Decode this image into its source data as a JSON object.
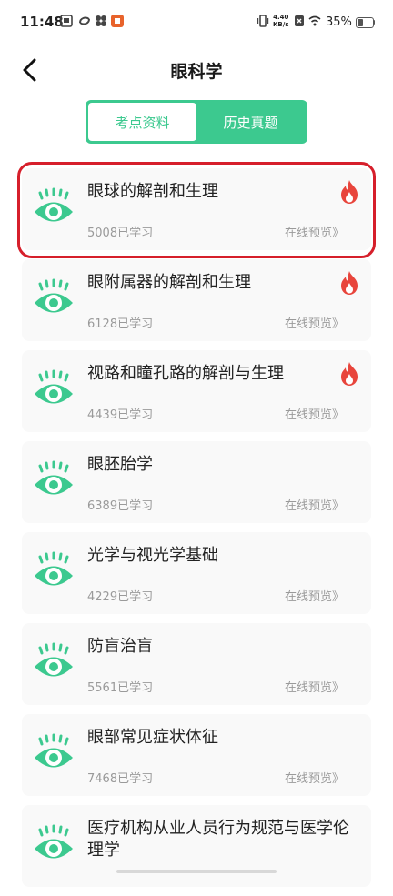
{
  "status_bar": {
    "time": "11:48",
    "net_speed_value": "4.40",
    "net_speed_unit": "KB/s",
    "battery_percent": "35%",
    "battery_level": 0.35
  },
  "header": {
    "title": "眼科学"
  },
  "tabs": [
    {
      "label": "考点资料",
      "active": true
    },
    {
      "label": "历史真题",
      "active": false
    }
  ],
  "accent_color": "#3cc98f",
  "hot_color": "#e8453c",
  "highlight_color": "#d61f2b",
  "courses": [
    {
      "title": "眼球的解剖和生理",
      "learned": "5008已学习",
      "preview": "在线预览》",
      "hot": true,
      "icon": "eye-icon"
    },
    {
      "title": "眼附属器的解剖和生理",
      "learned": "6128已学习",
      "preview": "在线预览》",
      "hot": true,
      "icon": "eye-icon"
    },
    {
      "title": "视路和瞳孔路的解剖与生理",
      "learned": "4439已学习",
      "preview": "在线预览》",
      "hot": true,
      "icon": "eye-icon"
    },
    {
      "title": "眼胚胎学",
      "learned": "6389已学习",
      "preview": "在线预览》",
      "hot": false,
      "icon": "eye-icon"
    },
    {
      "title": "光学与视光学基础",
      "learned": "4229已学习",
      "preview": "在线预览》",
      "hot": false,
      "icon": "eye-icon"
    },
    {
      "title": "防盲治盲",
      "learned": "5561已学习",
      "preview": "在线预览》",
      "hot": false,
      "icon": "eye-icon"
    },
    {
      "title": "眼部常见症状体征",
      "learned": "7468已学习",
      "preview": "在线预览》",
      "hot": false,
      "icon": "eye-icon"
    },
    {
      "title": "医疗机构从业人员行为规范与医学伦理学",
      "learned": "",
      "preview": "",
      "hot": false,
      "icon": "eye-icon"
    }
  ]
}
